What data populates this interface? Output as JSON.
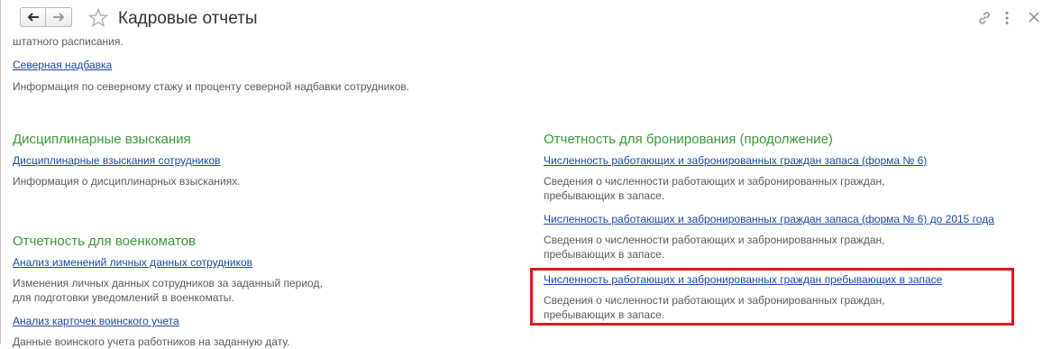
{
  "header": {
    "title": "Кадровые отчеты"
  },
  "sections": {
    "top": {
      "cut_text": "штатного расписания.",
      "northern": {
        "link": "Северная надбавка",
        "desc": "Информация по северному стажу и проценту северной надбавки сотрудников."
      }
    },
    "disciplinary": {
      "heading": "Дисциплинарные взыскания",
      "link": "Дисциплинарные взыскания сотрудников",
      "desc": "Информация о дисциплинарных взысканиях."
    },
    "military": {
      "heading": "Отчетность для военкоматов",
      "item1": {
        "link": "Анализ изменений личных данных сотрудников",
        "desc_line1": "Изменения личных данных сотрудников за заданный период,",
        "desc_line2": "для подготовки уведомлений в военкоматы."
      },
      "item2": {
        "link": "Анализ карточек воинского учета",
        "desc": "Данные воинского учета работников на заданную дату."
      }
    },
    "reservation": {
      "heading": "Отчетность для бронирования (продолжение)",
      "item1": {
        "link": "Численность работающих и забронированных граждан запаса (форма № 6)",
        "desc_line1": "Сведения о численности работающих и забронированных граждан,",
        "desc_line2": "пребывающих в запасе."
      },
      "item2": {
        "link": "Численность работающих и забронированных граждан запаса (форма № 6) до 2015 года",
        "desc_line1": "Сведения о численности работающих и забронированных граждан,",
        "desc_line2": "пребывающих в запасе."
      },
      "item3": {
        "link": "Численность работающих и забронированных граждан пребывающих в запасе",
        "desc_line1": "Сведения о численности работающих и забронированных граждан,",
        "desc_line2": "пребывающих в запасе."
      }
    }
  },
  "colors": {
    "link": "#1a4ba3",
    "heading": "#3a9b3a",
    "highlight": "#e0161c"
  },
  "icons": [
    "back-arrow-icon",
    "forward-arrow-icon",
    "star-icon",
    "link-icon",
    "more-icon",
    "close-icon"
  ]
}
